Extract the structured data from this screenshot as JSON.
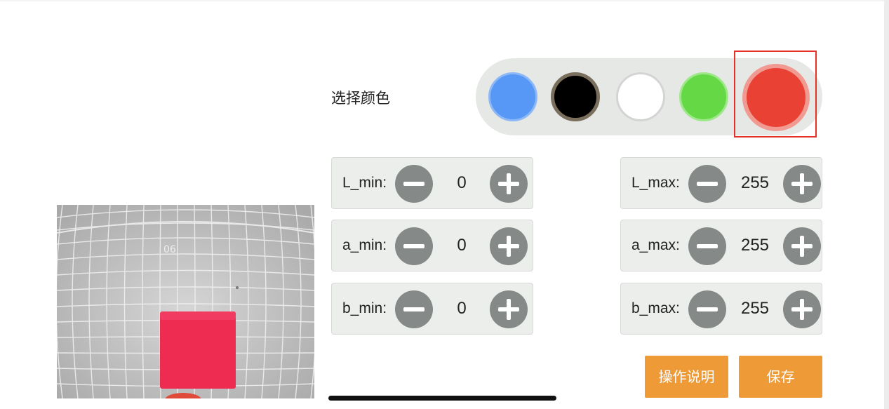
{
  "color_picker": {
    "label": "选择颜色",
    "swatches": [
      {
        "name": "blue",
        "color": "#5797f5"
      },
      {
        "name": "black",
        "color": "#000000"
      },
      {
        "name": "white",
        "color": "#ffffff"
      },
      {
        "name": "green",
        "color": "#65d845"
      },
      {
        "name": "red",
        "color": "#e94235"
      }
    ],
    "selected": "red",
    "selection_color": "#e53226"
  },
  "controls": {
    "L_min": {
      "label": "L_min:",
      "value": "0"
    },
    "a_min": {
      "label": "a_min:",
      "value": "0"
    },
    "b_min": {
      "label": "b_min:",
      "value": "0"
    },
    "L_max": {
      "label": "L_max:",
      "value": "255"
    },
    "a_max": {
      "label": "a_max:",
      "value": "255"
    },
    "b_max": {
      "label": "b_max:",
      "value": "255"
    }
  },
  "actions": {
    "instructions_label": "操作说明",
    "save_label": "保存",
    "button_color": "#ee9a37"
  },
  "camera": {
    "overlay_text": "06"
  }
}
